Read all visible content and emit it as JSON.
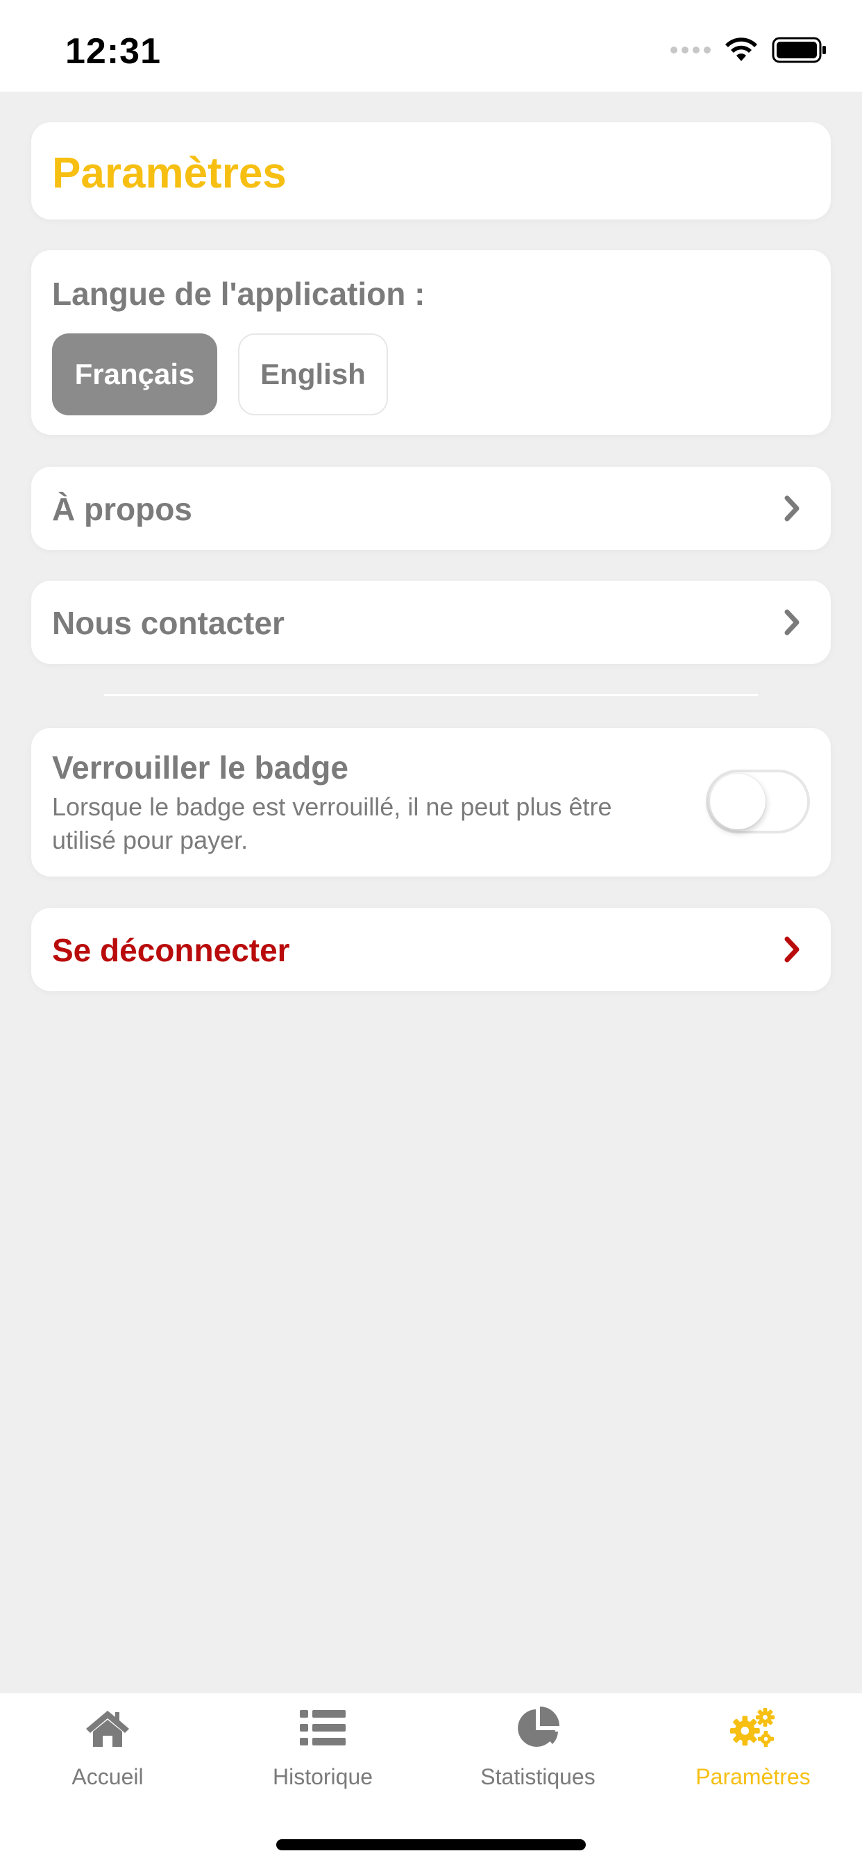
{
  "status_bar": {
    "time": "12:31"
  },
  "page": {
    "title": "Paramètres"
  },
  "language": {
    "label": "Langue de l'application :",
    "options": [
      "Français",
      "English"
    ],
    "selected": "Français"
  },
  "menu": {
    "about": "À propos",
    "contact": "Nous contacter"
  },
  "lock_badge": {
    "title": "Verrouiller le badge",
    "description": "Lorsque le badge est verrouillé, il ne peut plus être utilisé pour payer.",
    "enabled": false
  },
  "logout": {
    "label": "Se déconnecter"
  },
  "tabs": [
    {
      "label": "Accueil",
      "icon": "home-icon",
      "active": false
    },
    {
      "label": "Historique",
      "icon": "list-icon",
      "active": false
    },
    {
      "label": "Statistiques",
      "icon": "pie-chart-icon",
      "active": false
    },
    {
      "label": "Paramètres",
      "icon": "gears-icon",
      "active": true
    }
  ],
  "colors": {
    "accent": "#f6bf12",
    "danger": "#b90b0b",
    "text_muted": "#7b7b7b",
    "background": "#efefef"
  }
}
